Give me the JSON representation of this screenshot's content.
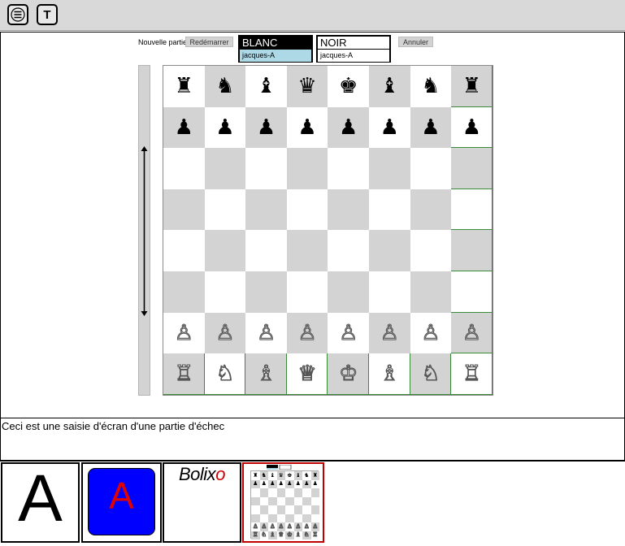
{
  "toolbar": {
    "menu_icon": "hamburger-menu-icon",
    "text_label": "T"
  },
  "game": {
    "new_game_label": "Nouvelle partie",
    "restart_label": "Redémarrer",
    "cancel_label": "Annuler",
    "white": {
      "label": "BLANC",
      "name": "jacques-A",
      "header_bg": "#000000",
      "header_fg": "#ffffff",
      "name_bg": "#add8e6"
    },
    "black": {
      "label": "NOIR",
      "name": "jacques-A",
      "header_bg": "#ffffff",
      "header_fg": "#000000",
      "name_bg": "#ffffff"
    }
  },
  "board": {
    "light_color": "#ffffff",
    "dark_color": "#d3d3d3",
    "rows": [
      [
        "♜",
        "♞",
        "♝",
        "♛",
        "♚",
        "♝",
        "♞",
        "♜"
      ],
      [
        "♟",
        "♟",
        "♟",
        "♟",
        "♟",
        "♟",
        "♟",
        "♟"
      ],
      [
        "",
        "",
        "",
        "",
        "",
        "",
        "",
        ""
      ],
      [
        "",
        "",
        "",
        "",
        "",
        "",
        "",
        ""
      ],
      [
        "",
        "",
        "",
        "",
        "",
        "",
        "",
        ""
      ],
      [
        "",
        "",
        "",
        "",
        "",
        "",
        "",
        ""
      ],
      [
        "♙",
        "♙",
        "♙",
        "♙",
        "♙",
        "♙",
        "♙",
        "♙"
      ],
      [
        "♖",
        "♘",
        "♗",
        "♕",
        "♔",
        "♗",
        "♘",
        "♖"
      ]
    ]
  },
  "caption": {
    "text": "Ceci est une saisie d'écran d'une partie d'échec"
  },
  "thumbnails": {
    "plain_letter": "A",
    "blue_letter": "A",
    "bolixo_prefix": "Bolix",
    "bolixo_suffix": "o",
    "selected_color": "#c00000"
  }
}
